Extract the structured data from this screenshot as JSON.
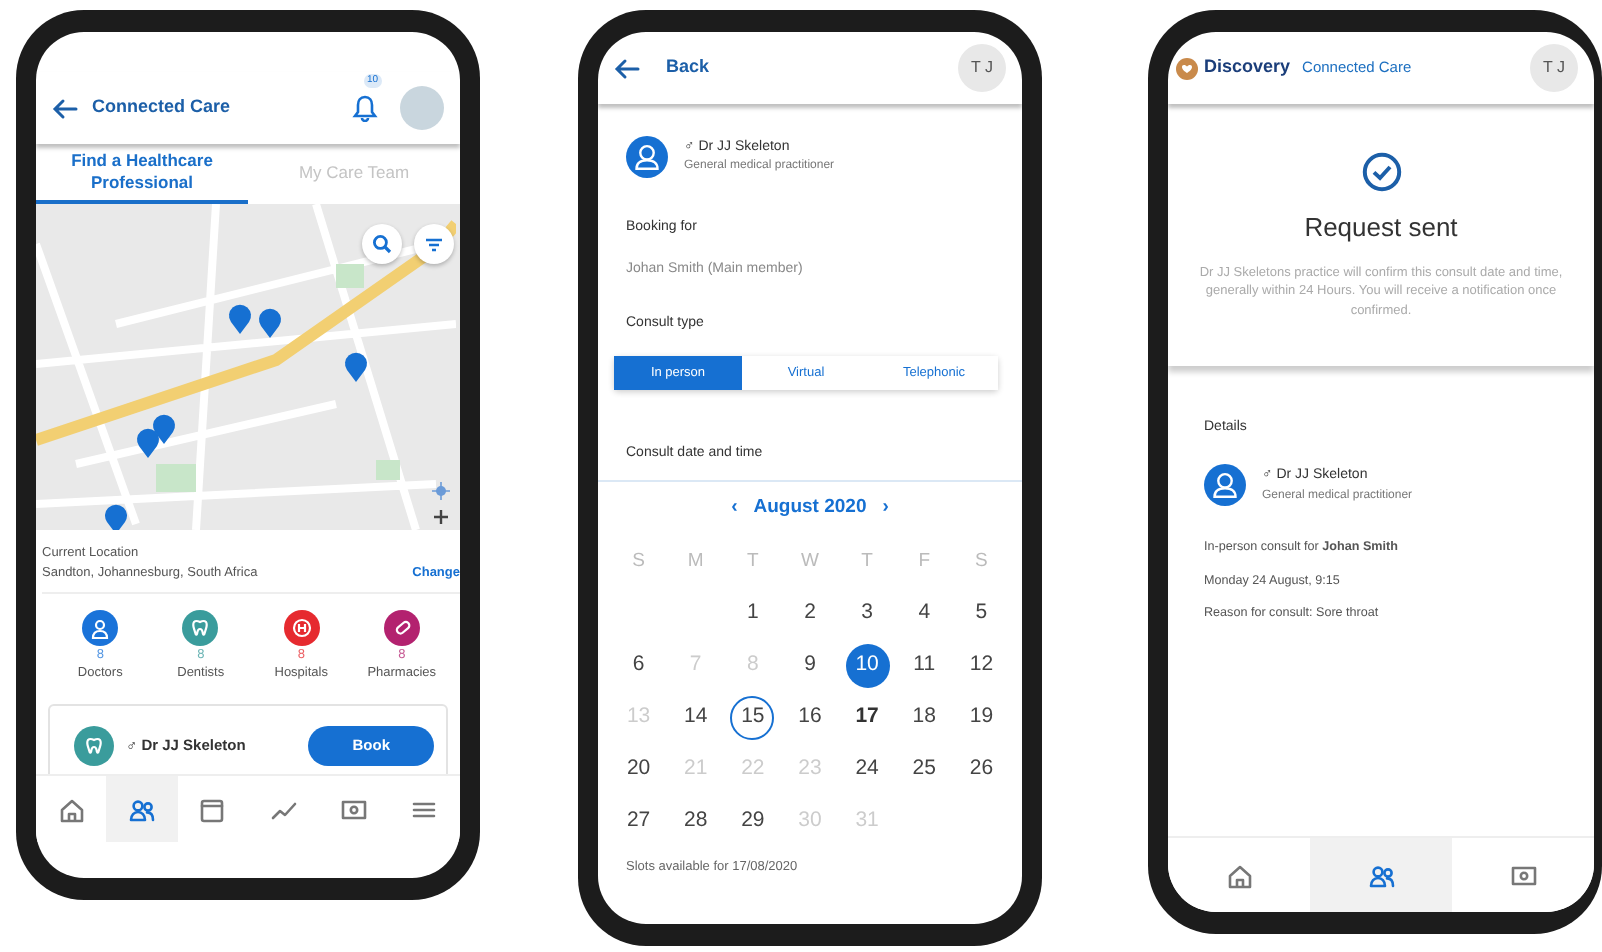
{
  "find_screen": {
    "header": {
      "title": "Connected Care",
      "notification_count": "10"
    },
    "tabs": [
      {
        "label": "Find a Healthcare Professional",
        "selected": true
      },
      {
        "label": "My Care Team",
        "selected": false
      }
    ],
    "location": {
      "label": "Current Location",
      "value": "Sandton, Johannesburg, South Africa",
      "action": "Change"
    },
    "categories": [
      {
        "kind": "doctor",
        "count": "8",
        "label": "Doctors",
        "color": "#1a73d9"
      },
      {
        "kind": "tooth",
        "count": "8",
        "label": "Dentists",
        "color": "#3a9c9c"
      },
      {
        "kind": "hospital",
        "count": "8",
        "label": "Hospitals",
        "color": "#e62a2f"
      },
      {
        "kind": "pill",
        "count": "8",
        "label": "Pharmacies",
        "color": "#b3226f"
      }
    ],
    "doctor_card": {
      "name": "♂ Dr JJ Skeleton",
      "button": "Book"
    },
    "nav": [
      {
        "kind": "home",
        "selected": false
      },
      {
        "kind": "team",
        "selected": true
      },
      {
        "kind": "calendar",
        "selected": false
      },
      {
        "kind": "chart",
        "selected": false
      },
      {
        "kind": "ticket",
        "selected": false
      },
      {
        "kind": "menu",
        "selected": false
      }
    ]
  },
  "booking_screen": {
    "header": {
      "back": "Back",
      "initials": "T J"
    },
    "doctor": {
      "name": "♂ Dr JJ Skeleton",
      "specialty": "General medical practitioner"
    },
    "booking_for": {
      "label": "Booking for",
      "value": "Johan Smith (Main member)"
    },
    "consult_type": {
      "label": "Consult type",
      "options": [
        {
          "label": "In person",
          "selected": true
        },
        {
          "label": "Virtual",
          "selected": false
        },
        {
          "label": "Telephonic",
          "selected": false
        }
      ]
    },
    "date_label": "Consult date and time",
    "calendar": {
      "prev": "‹",
      "month": "August 2020",
      "next": "›",
      "weekdays": [
        "S",
        "M",
        "T",
        "W",
        "T",
        "F",
        "S"
      ],
      "weeks": [
        [
          {
            "kind": "blank"
          },
          {
            "kind": "blank"
          },
          {
            "day": "1",
            "available": true,
            "selected": false,
            "today": false,
            "highlighted": false
          },
          {
            "day": "2",
            "available": true,
            "selected": false,
            "today": false,
            "highlighted": false
          },
          {
            "day": "3",
            "available": true,
            "selected": false,
            "today": false,
            "highlighted": false
          },
          {
            "day": "4",
            "available": true,
            "selected": false,
            "today": false,
            "highlighted": false
          },
          {
            "day": "5",
            "available": true,
            "selected": false,
            "today": false,
            "highlighted": false
          }
        ],
        [
          {
            "day": "6",
            "available": true,
            "selected": false,
            "today": false,
            "highlighted": false
          },
          {
            "day": "7",
            "available": false,
            "selected": false,
            "today": false,
            "highlighted": false
          },
          {
            "day": "8",
            "available": false,
            "selected": false,
            "today": false,
            "highlighted": false
          },
          {
            "day": "9",
            "available": true,
            "selected": false,
            "today": false,
            "highlighted": false
          },
          {
            "day": "10",
            "available": true,
            "selected": true,
            "today": false,
            "highlighted": false
          },
          {
            "day": "11",
            "available": true,
            "selected": false,
            "today": false,
            "highlighted": false
          },
          {
            "day": "12",
            "available": true,
            "selected": false,
            "today": false,
            "highlighted": false
          }
        ],
        [
          {
            "day": "13",
            "available": false,
            "selected": false,
            "today": false,
            "highlighted": false
          },
          {
            "day": "14",
            "available": true,
            "selected": false,
            "today": false,
            "highlighted": false
          },
          {
            "day": "15",
            "available": true,
            "selected": false,
            "today": true,
            "highlighted": false
          },
          {
            "day": "16",
            "available": true,
            "selected": false,
            "today": false,
            "highlighted": false
          },
          {
            "day": "17",
            "available": true,
            "selected": false,
            "today": false,
            "highlighted": true
          },
          {
            "day": "18",
            "available": true,
            "selected": false,
            "today": false,
            "highlighted": false
          },
          {
            "day": "19",
            "available": true,
            "selected": false,
            "today": false,
            "highlighted": false
          }
        ],
        [
          {
            "day": "20",
            "available": true,
            "selected": false,
            "today": false,
            "highlighted": false
          },
          {
            "day": "21",
            "available": false,
            "selected": false,
            "today": false,
            "highlighted": false
          },
          {
            "day": "22",
            "available": false,
            "selected": false,
            "today": false,
            "highlighted": false
          },
          {
            "day": "23",
            "available": false,
            "selected": false,
            "today": false,
            "highlighted": false
          },
          {
            "day": "24",
            "available": true,
            "selected": false,
            "today": false,
            "highlighted": false
          },
          {
            "day": "25",
            "available": true,
            "selected": false,
            "today": false,
            "highlighted": false
          },
          {
            "day": "26",
            "available": true,
            "selected": false,
            "today": false,
            "highlighted": false
          }
        ],
        [
          {
            "day": "27",
            "available": true,
            "selected": false,
            "today": false,
            "highlighted": false
          },
          {
            "day": "28",
            "available": true,
            "selected": false,
            "today": false,
            "highlighted": false
          },
          {
            "day": "29",
            "available": true,
            "selected": false,
            "today": false,
            "highlighted": false
          },
          {
            "day": "30",
            "available": false,
            "selected": false,
            "today": false,
            "highlighted": false
          },
          {
            "day": "31",
            "available": false,
            "selected": false,
            "today": false,
            "highlighted": false
          }
        ]
      ]
    },
    "slots_text": "Slots available for 17/08/2020"
  },
  "confirmation_screen": {
    "header": {
      "brand": "Discovery",
      "product": "Connected Care",
      "initials": "T J"
    },
    "title": "Request sent",
    "message": "Dr JJ Skeletons practice will confirm this consult date and time, generally within 24 Hours. You will receive a notification once confirmed.",
    "details_label": "Details",
    "doctor": {
      "name": "♂ Dr JJ Skeleton",
      "specialty": "General medical practitioner"
    },
    "lines": [
      "In-person consult for **Johan Smith**",
      "Monday 24 August, 9:15",
      "Reason for consult: Sore throat"
    ],
    "nav": [
      {
        "kind": "home",
        "selected": false
      },
      {
        "kind": "team",
        "selected": true
      },
      {
        "kind": "ticket",
        "selected": false
      }
    ]
  }
}
